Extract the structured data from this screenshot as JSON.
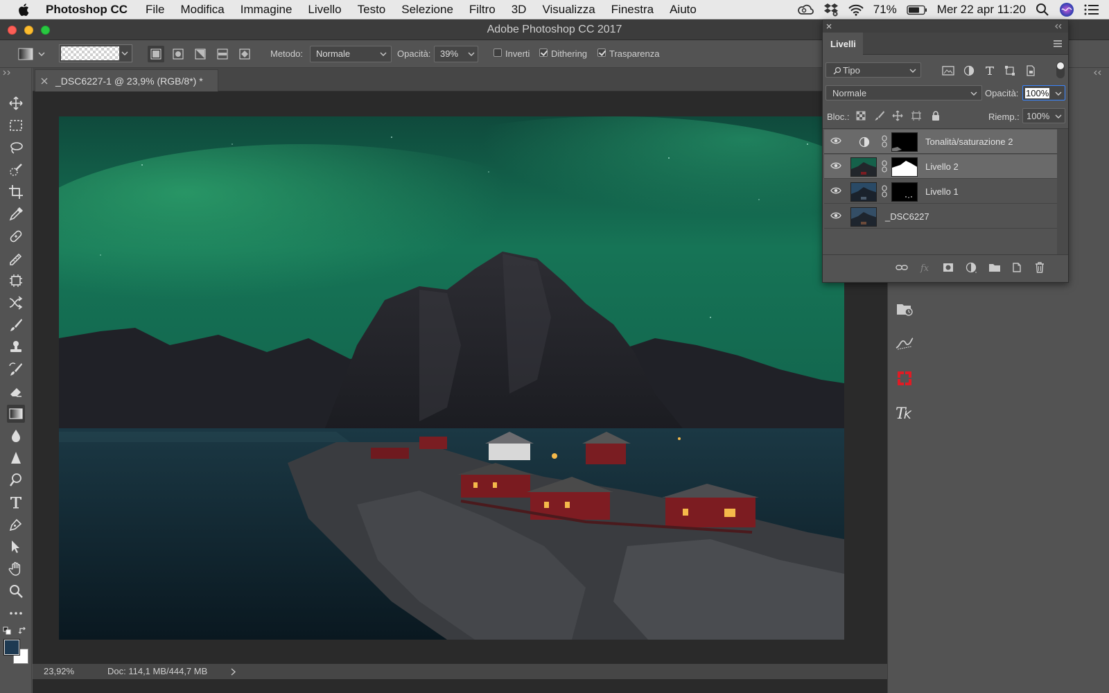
{
  "menubar": {
    "app_name": "Photoshop CC",
    "items": [
      "File",
      "Modifica",
      "Immagine",
      "Livello",
      "Testo",
      "Selezione",
      "Filtro",
      "3D",
      "Visualizza",
      "Finestra",
      "Aiuto"
    ],
    "battery": "71%",
    "clock": "Mer 22 apr  11:20"
  },
  "window": {
    "title": "Adobe Photoshop CC 2017"
  },
  "options": {
    "method_label": "Metodo:",
    "method_value": "Normale",
    "opacity_label": "Opacità:",
    "opacity_value": "39%",
    "invert_label": "Inverti",
    "invert_checked": false,
    "dither_label": "Dithering",
    "dither_checked": true,
    "transparency_label": "Trasparenza",
    "transparency_checked": true
  },
  "document": {
    "tab_title": "_DSC6227-1 @ 23,9% (RGB/8*) *",
    "zoom": "23,92%",
    "doc_info": "Doc: 114,1 MB/444,7 MB"
  },
  "layers_panel": {
    "tab_label": "Livelli",
    "filter_kind": "Tipo",
    "blend_mode": "Normale",
    "opacity_label": "Opacità:",
    "opacity_value": "100%",
    "lock_label": "Bloc.:",
    "fill_label": "Riemp.:",
    "fill_value": "100%",
    "layers": [
      {
        "name": "Tonalità/saturazione 2",
        "type": "adjustment",
        "visible": true,
        "selected": true
      },
      {
        "name": "Livello 2",
        "type": "masked",
        "visible": true,
        "selected": true
      },
      {
        "name": "Livello 1",
        "type": "masked",
        "visible": true,
        "selected": false
      },
      {
        "name": "_DSC6227",
        "type": "background",
        "visible": true,
        "selected": false
      }
    ]
  },
  "colors": {
    "menubar_bg": "#e8e8e8",
    "panel_bg": "#535353",
    "canvas_bg": "#2a2a2a",
    "selected_layer": "#6a6a6a",
    "aurora_green": "#1f8a5e",
    "accent_blue": "#3a86ff"
  }
}
